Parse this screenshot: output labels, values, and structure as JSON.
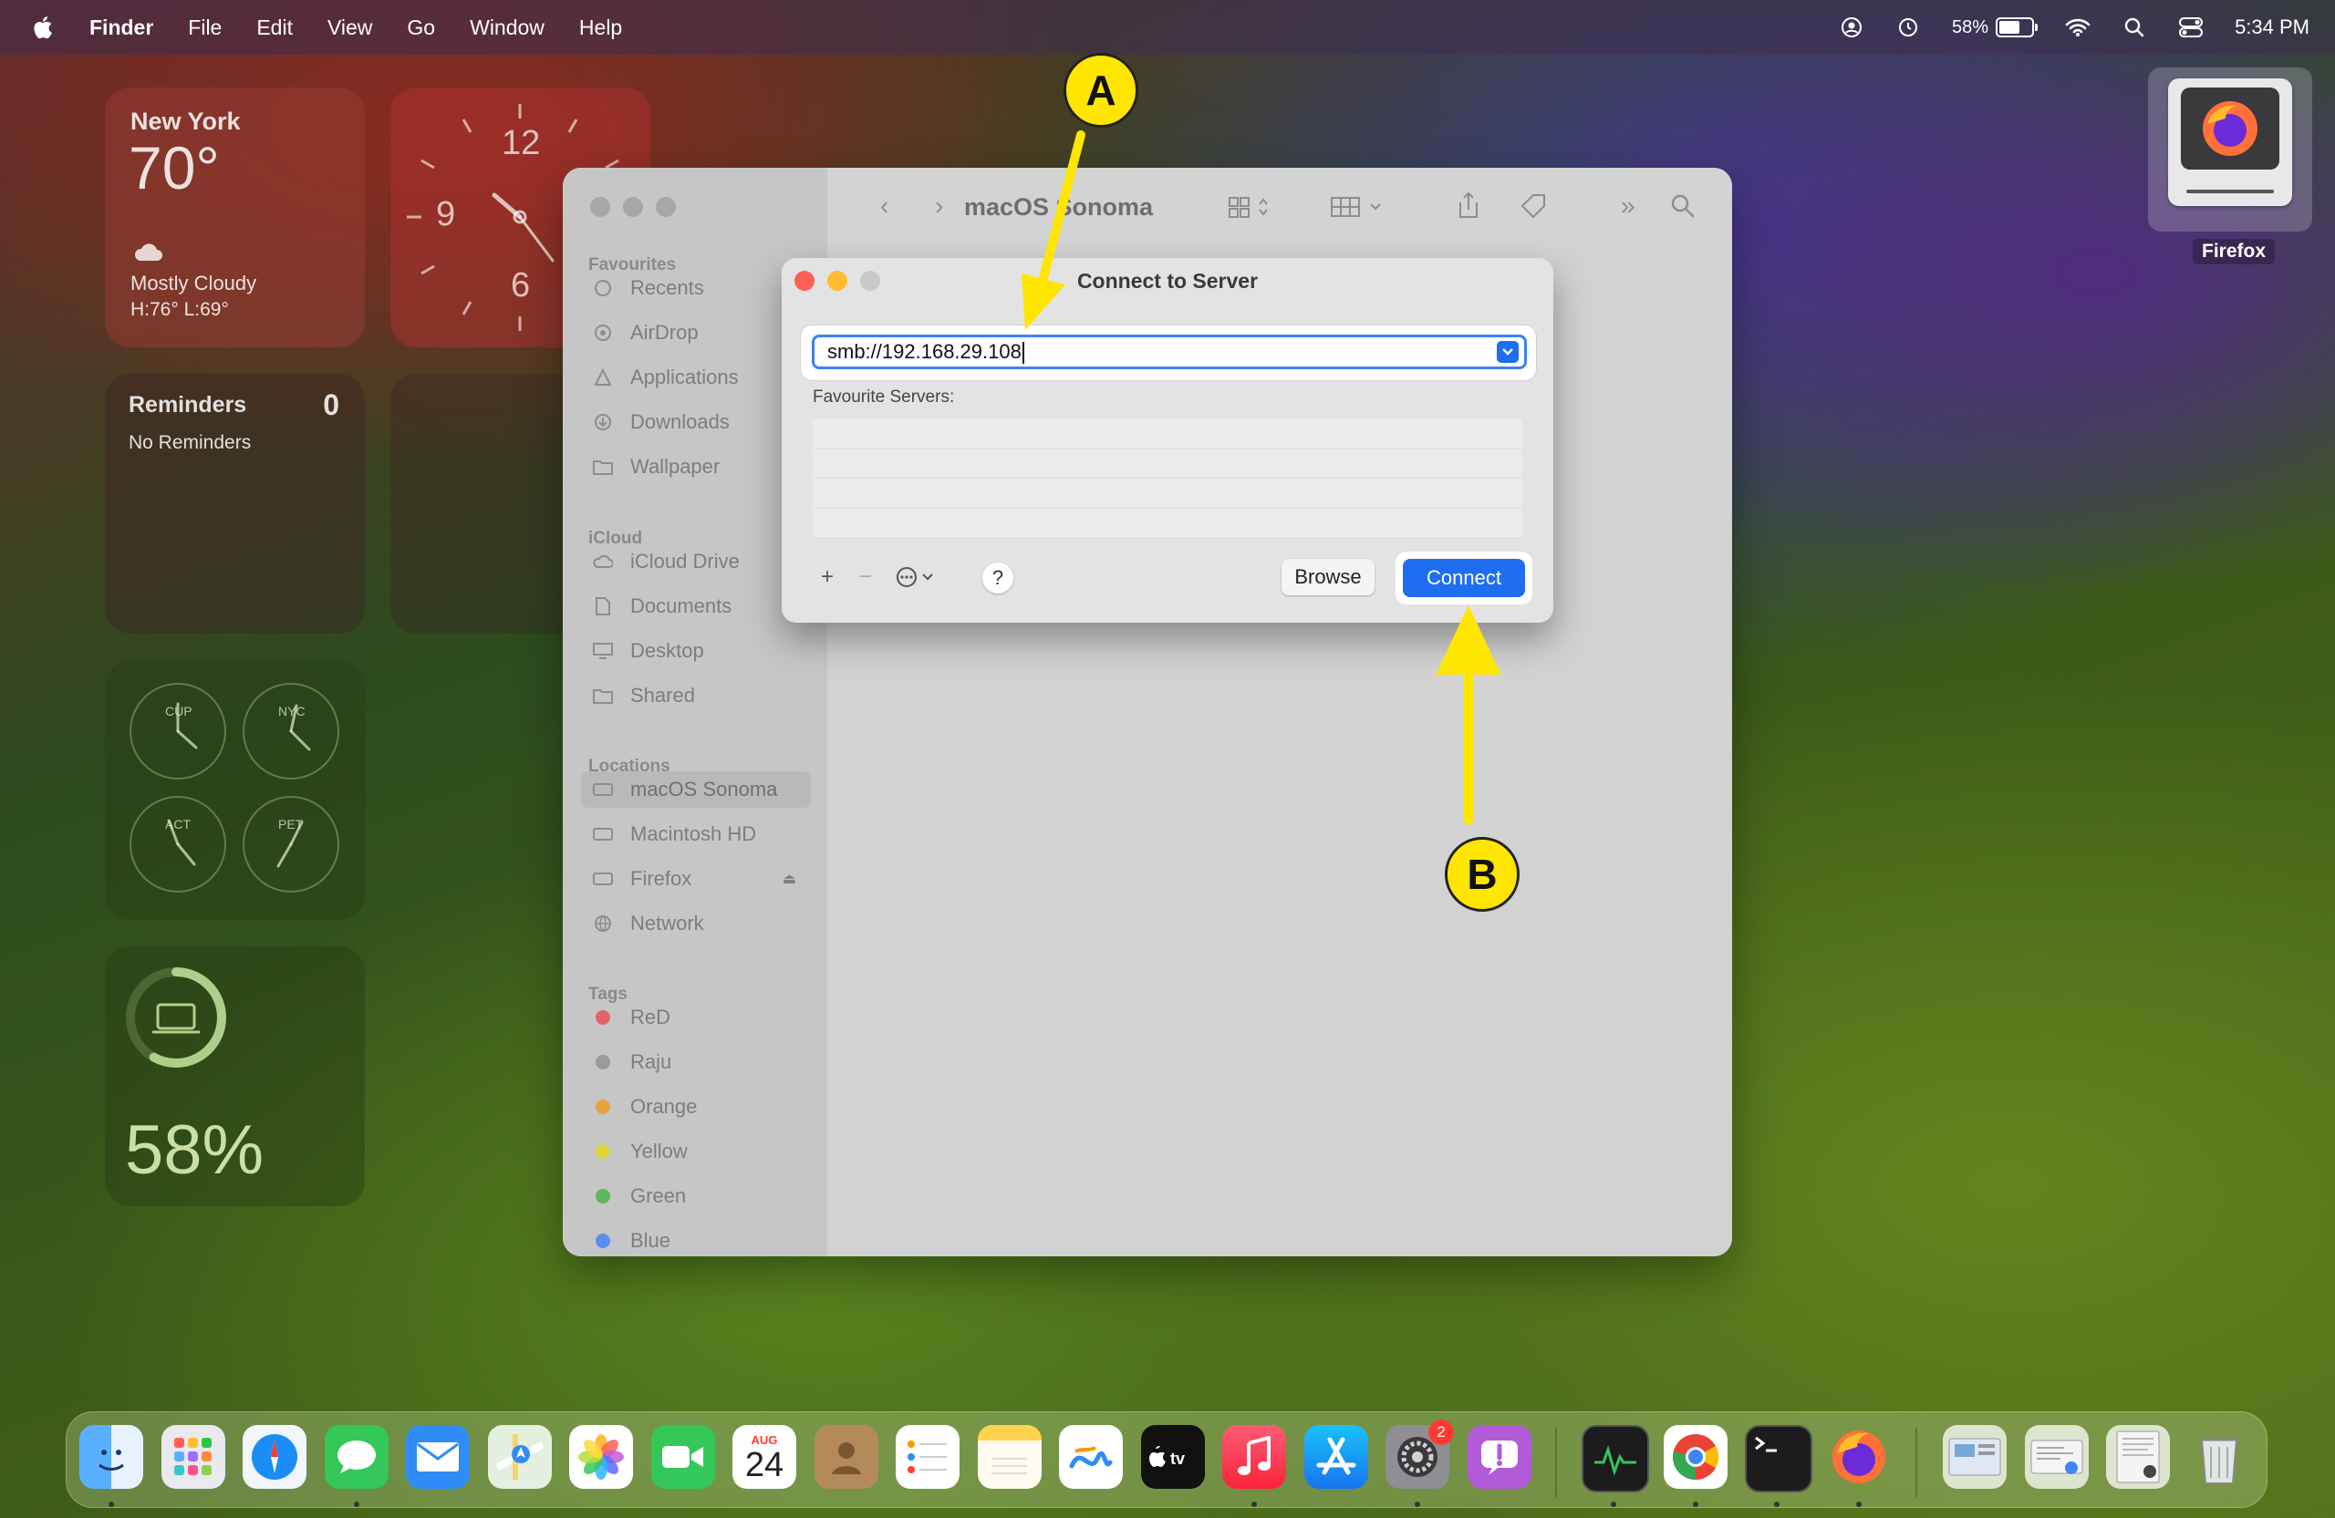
{
  "menubar": {
    "app": "Finder",
    "items": [
      "File",
      "Edit",
      "View",
      "Go",
      "Window",
      "Help"
    ],
    "battery": "58%",
    "time": "5:34 PM"
  },
  "widgets": {
    "weather": {
      "city": "New York",
      "temp": "70°",
      "condition": "Mostly Cloudy",
      "hilo": "H:76° L:69°"
    },
    "clock": {
      "numerals": [
        "12",
        "9",
        "6"
      ]
    },
    "reminders": {
      "title": "Reminders",
      "count": "0",
      "empty": "No Reminders"
    },
    "world_clocks": [
      "CUP",
      "NYC",
      "ACT",
      "PET"
    ],
    "battery": {
      "percent": "58%",
      "level": 0.58
    }
  },
  "desktop": {
    "disk_label": "Firefox"
  },
  "finder": {
    "title": "macOS Sonoma",
    "sections": {
      "favourites": "Favourites",
      "icloud": "iCloud",
      "locations": "Locations",
      "tags": "Tags"
    },
    "favourites": [
      "Recents",
      "AirDrop",
      "Applications",
      "Downloads",
      "Wallpaper"
    ],
    "icloud": [
      "iCloud Drive",
      "Documents",
      "Desktop",
      "Shared"
    ],
    "locations": [
      "macOS Sonoma",
      "Macintosh HD",
      "Firefox",
      "Network"
    ],
    "tags": [
      {
        "name": "ReD",
        "color": "#e06666"
      },
      {
        "name": "Raju",
        "color": "#9a9a9a"
      },
      {
        "name": "Orange",
        "color": "#e6a23c"
      },
      {
        "name": "Yellow",
        "color": "#e6d23c"
      },
      {
        "name": "Green",
        "color": "#5cb85c"
      },
      {
        "name": "Blue",
        "color": "#5b8def"
      }
    ]
  },
  "dialog": {
    "title": "Connect to Server",
    "url_value": "smb://192.168.29.108",
    "favourite_label": "Favourite Servers:",
    "browse": "Browse",
    "connect": "Connect",
    "help": "?",
    "add": "+",
    "remove": "−"
  },
  "annotations": {
    "a": "A",
    "b": "B",
    "accent": "#ffe600"
  },
  "dock": {
    "calendar_month": "AUG",
    "calendar_day": "24",
    "settings_badge": "2",
    "apps": [
      "finder-icon",
      "launchpad-icon",
      "safari-icon",
      "messages-icon",
      "mail-icon",
      "maps-icon",
      "photos-icon",
      "facetime-icon",
      "calendar-icon",
      "contacts-icon",
      "reminders-icon",
      "notes-icon",
      "freeform-icon",
      "tv-icon",
      "music-icon",
      "appstore-icon",
      "settings-icon",
      "feedback-icon",
      "activity-monitor-icon",
      "chrome-icon",
      "terminal-icon",
      "firefox-icon"
    ]
  }
}
